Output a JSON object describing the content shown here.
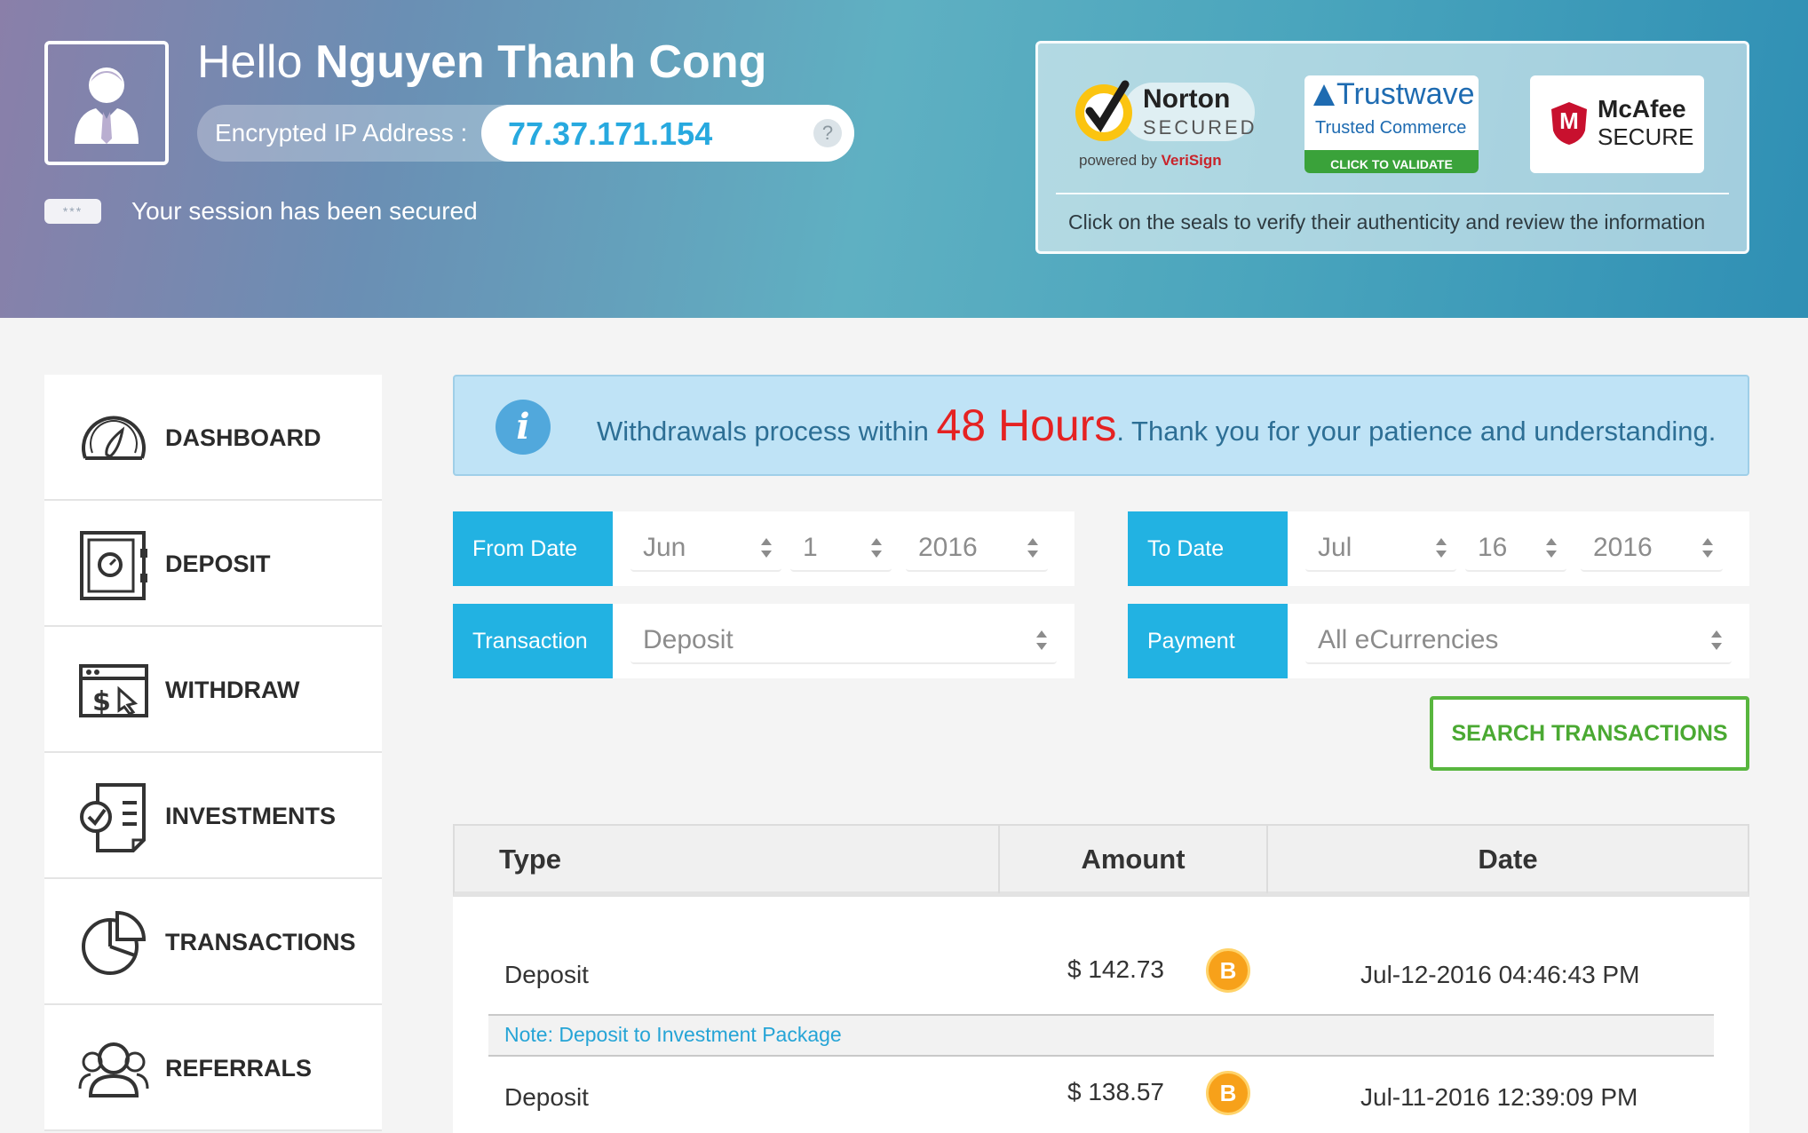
{
  "header": {
    "greeting": "Hello",
    "user_name": "Nguyen Thanh Cong",
    "ip_label": "Encrypted IP Address :",
    "ip_value": "77.37.171.154",
    "ip_help": "?",
    "session_badge": "***",
    "session_text": "Your session has been secured",
    "avatar_icon": "user-avatar-icon"
  },
  "seals": {
    "norton": {
      "title": "Norton",
      "subtitle": "SECURED",
      "powered": "powered by ",
      "brand": "VeriSign"
    },
    "trustwave": {
      "title": "Trustwave",
      "subtitle": "Trusted Commerce",
      "cta": "CLICK TO VALIDATE"
    },
    "mcafee": {
      "title": "McAfee",
      "subtitle": "SECURE",
      "mark": "M"
    },
    "note": "Click on the seals to verify their authenticity and review the information"
  },
  "sidebar": {
    "items": [
      {
        "label": "DASHBOARD",
        "icon": "speedometer-icon"
      },
      {
        "label": "DEPOSIT",
        "icon": "safe-icon"
      },
      {
        "label": "WITHDRAW",
        "icon": "browser-dollar-icon"
      },
      {
        "label": "INVESTMENTS",
        "icon": "checklist-icon"
      },
      {
        "label": "TRANSACTIONS",
        "icon": "pie-chart-icon"
      },
      {
        "label": "REFERRALS",
        "icon": "users-icon"
      }
    ]
  },
  "alert": {
    "icon": "i",
    "before": "Withdrawals process within ",
    "highlight": "48 Hours",
    "after": ". Thank you for your patience and understanding."
  },
  "filters": {
    "from_label": "From Date",
    "from_month": "Jun",
    "from_day": "1",
    "from_year": "2016",
    "to_label": "To Date",
    "to_month": "Jul",
    "to_day": "16",
    "to_year": "2016",
    "transaction_label": "Transaction",
    "transaction_value": "Deposit",
    "payment_label": "Payment",
    "payment_value": "All eCurrencies",
    "search_button": "SEARCH TRANSACTIONS"
  },
  "table": {
    "columns": [
      "Type",
      "Amount",
      "Date"
    ],
    "rows": [
      {
        "type": "Deposit",
        "amount": "$ 142.73",
        "currency_icon": "bitcoin-icon",
        "coin": "B",
        "date": "Jul-12-2016 04:46:43 PM",
        "note": "Note: Deposit to Investment Package"
      },
      {
        "type": "Deposit",
        "amount": "$ 138.57",
        "currency_icon": "bitcoin-icon",
        "coin": "B",
        "date": "Jul-11-2016 12:39:09 PM"
      }
    ]
  },
  "colors": {
    "accent": "#22b2e2",
    "button_green": "#58b63e",
    "highlight_red": "#e52222",
    "bitcoin": "#f7a11a"
  }
}
